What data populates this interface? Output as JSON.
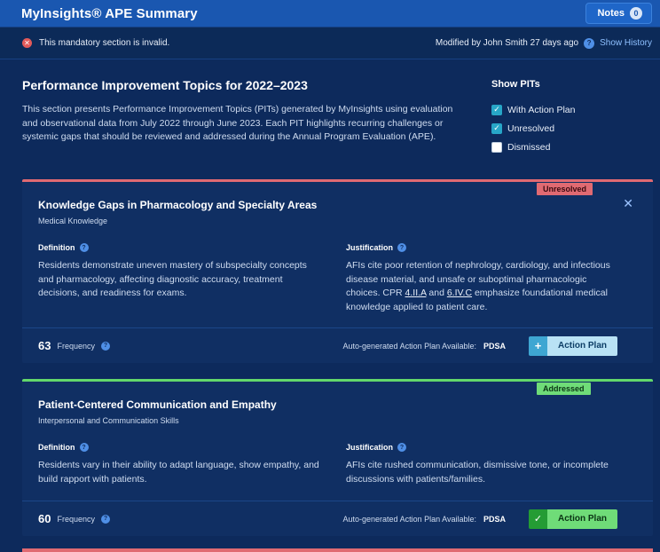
{
  "header": {
    "title": "MyInsights® APE Summary",
    "notes_label": "Notes",
    "notes_count": "0"
  },
  "status": {
    "error_icon": "close-circle-icon",
    "message": "This mandatory section is invalid.",
    "modified": "Modified by John Smith 27 days ago",
    "history_link": "Show History"
  },
  "intro": {
    "title": "Performance Improvement Topics for 2022–2023",
    "description": "This section presents Performance Improvement Topics (PITs) generated by MyInsights using evaluation and observational data from July 2022 through June 2023. Each PIT highlights recurring challenges or systemic gaps that should be reviewed and addressed during the Annual Program Evaluation (APE)."
  },
  "filters": {
    "title": "Show PITs",
    "options": [
      {
        "label": "With Action Plan",
        "checked": true
      },
      {
        "label": "Unresolved",
        "checked": true
      },
      {
        "label": "Dismissed",
        "checked": false
      }
    ]
  },
  "cards": [
    {
      "status": "Unresolved",
      "status_color": "#e06a72",
      "title": "Knowledge Gaps in Pharmacology and Specialty Areas",
      "subtitle": "Medical Knowledge",
      "definition_label": "Definition",
      "definition": "Residents demonstrate uneven mastery of subspecialty concepts and pharmacology, affecting diagnostic accuracy, treatment decisions, and readiness for exams.",
      "justification_label": "Justification",
      "justification_pre": "AFIs cite poor retention of nephrology, cardiology, and infectious disease material, and unsafe or suboptimal pharmacologic choices. CPR ",
      "justification_ref1": "4.II.A",
      "justification_mid": " and ",
      "justification_ref2": "6.IV.C",
      "justification_post": " emphasize foundational medical knowledge applied to patient care.",
      "frequency": "63",
      "frequency_label": "Frequency",
      "ap_label": "Auto-generated Action Plan Available:",
      "ap_type": "PDSA",
      "ap_button": "Action Plan",
      "ap_icon": "plus-icon"
    },
    {
      "status": "Addressed",
      "status_color": "#6fdc78",
      "title": "Patient-Centered Communication and Empathy",
      "subtitle": "Interpersonal and Communication Skills",
      "definition_label": "Definition",
      "definition": "Residents vary in their ability to adapt language, show empathy, and build rapport with patients.",
      "justification_label": "Justification",
      "justification": "AFIs cite rushed communication, dismissive tone, or incomplete discussions with patients/families.",
      "frequency": "60",
      "frequency_label": "Frequency",
      "ap_label": "Auto-generated Action Plan Available:",
      "ap_type": "PDSA",
      "ap_button": "Action Plan",
      "ap_icon": "check-icon"
    }
  ]
}
